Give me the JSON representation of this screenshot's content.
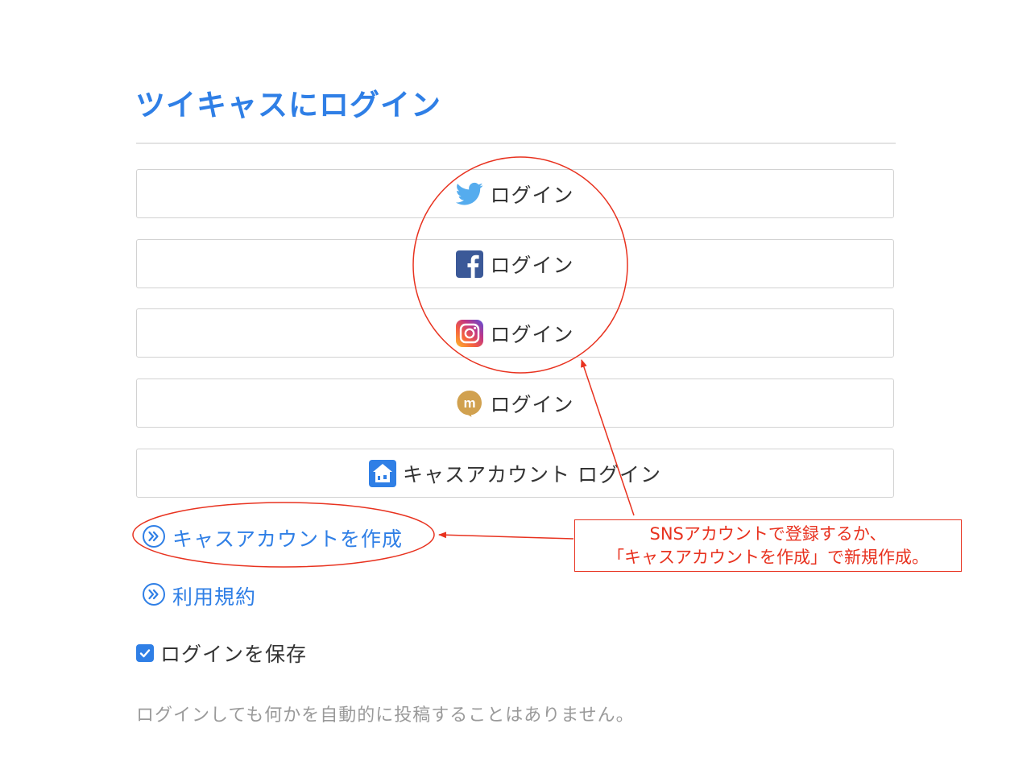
{
  "header": {
    "title": "ツイキャスにログイン"
  },
  "login_buttons": [
    {
      "id": "twitter",
      "icon": "twitter-icon",
      "label": "ログイン",
      "color": "#55acee"
    },
    {
      "id": "facebook",
      "icon": "facebook-icon",
      "label": "ログイン",
      "color": "#3b5998"
    },
    {
      "id": "instagram",
      "icon": "instagram-icon",
      "label": "ログイン",
      "color": "#c13584"
    },
    {
      "id": "mixi",
      "icon": "mixi-icon",
      "label": "ログイン",
      "color": "#d1a14f"
    },
    {
      "id": "cas",
      "icon": "twitcasting-icon",
      "label": "キャスアカウント ログイン",
      "color": "#2f7fe6"
    }
  ],
  "links": {
    "create_account": "キャスアカウントを作成",
    "terms": "利用規約"
  },
  "remember": {
    "label": "ログインを保存",
    "checked": true
  },
  "note": "ログインしても何かを自動的に投稿することはありません。",
  "annotation": {
    "line1": "SNSアカウントで登録するか、",
    "line2": "「キャスアカウントを作成」で新規作成。",
    "color": "#e8321f"
  },
  "colors": {
    "accent": "#2f7fe6",
    "text": "#333333",
    "muted": "#9a9a9a",
    "annotation": "#e8321f"
  }
}
